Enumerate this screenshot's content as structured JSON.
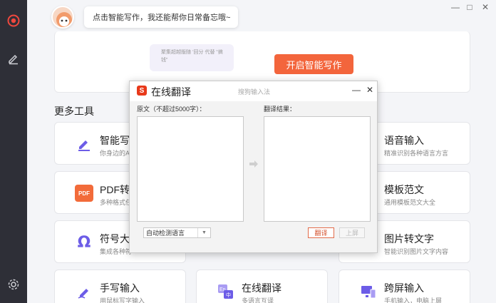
{
  "window": {
    "minimize": "—",
    "maximize": "□",
    "close": "✕"
  },
  "assistant": {
    "bubble_text": "点击智能写作，我还能帮你日常备忘哦~"
  },
  "banner": {
    "deco_text": "聚集超越版随 ‘回分 代替 “搞钱”",
    "cta_label": "开启智能写作"
  },
  "section": {
    "title": "更多工具"
  },
  "tools": {
    "t1": {
      "title": "智能写作",
      "sub": "你身边的AI",
      "icon": "pen-icon",
      "color": "#6c5ce7"
    },
    "t2": {
      "title": "PDF转换",
      "sub": "多种格式任",
      "icon": "pdf-icon",
      "color": "#f26b3a"
    },
    "t3": {
      "title": "符号大全",
      "sub": "集成各种符",
      "icon": "omega-icon",
      "color": "#6c5ce7"
    },
    "t4": {
      "title": "手写输入",
      "sub": "用鼠标写字输入",
      "icon": "handwriting-icon",
      "color": "#6c5ce7"
    },
    "t5": {
      "title": "在线翻译",
      "sub": "多语言互译",
      "icon": "translate-icon",
      "color": "#6c5ce7"
    },
    "t6": {
      "title": "语音输入",
      "sub": "精准识别各种语言方言",
      "icon": "microphone-icon",
      "color": "#6c5ce7"
    },
    "t7": {
      "title": "模板范文",
      "sub": "通用模板范文大全",
      "icon": "template-icon",
      "color": "#6c5ce7"
    },
    "t8": {
      "title": "图片转文字",
      "sub": "智能识别图片文字内容",
      "icon": "image-text-icon",
      "color": "#6c5ce7"
    },
    "t9": {
      "title": "跨屏输入",
      "sub": "手机输入，电脑上屏",
      "icon": "cross-screen-icon",
      "color": "#6c5ce7"
    }
  },
  "dialog": {
    "logo": "S",
    "title": "在线翻译",
    "brand": "搜狗输入法",
    "minimize": "—",
    "close": "✕",
    "source_label": "原文（不超过5000字）：",
    "result_label": "翻译结果：",
    "source_text": "",
    "result_text": "",
    "language_select": "自动检测语言",
    "translate_button": "翻译",
    "screen_button": "上屏"
  }
}
